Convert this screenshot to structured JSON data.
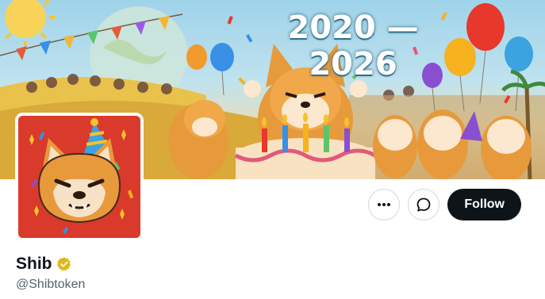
{
  "banner": {
    "year_text": "2020 — 2026"
  },
  "profile": {
    "display_name": "Shib",
    "handle": "@Shibtoken",
    "verified": true,
    "verified_color": "#e2b719"
  },
  "actions": {
    "more_icon": "more-horizontal-icon",
    "message_icon": "message-icon",
    "follow_label": "Follow"
  },
  "colors": {
    "follow_bg": "#0f1419",
    "avatar_bg": "#d93a2b",
    "handle_color": "#536471"
  }
}
